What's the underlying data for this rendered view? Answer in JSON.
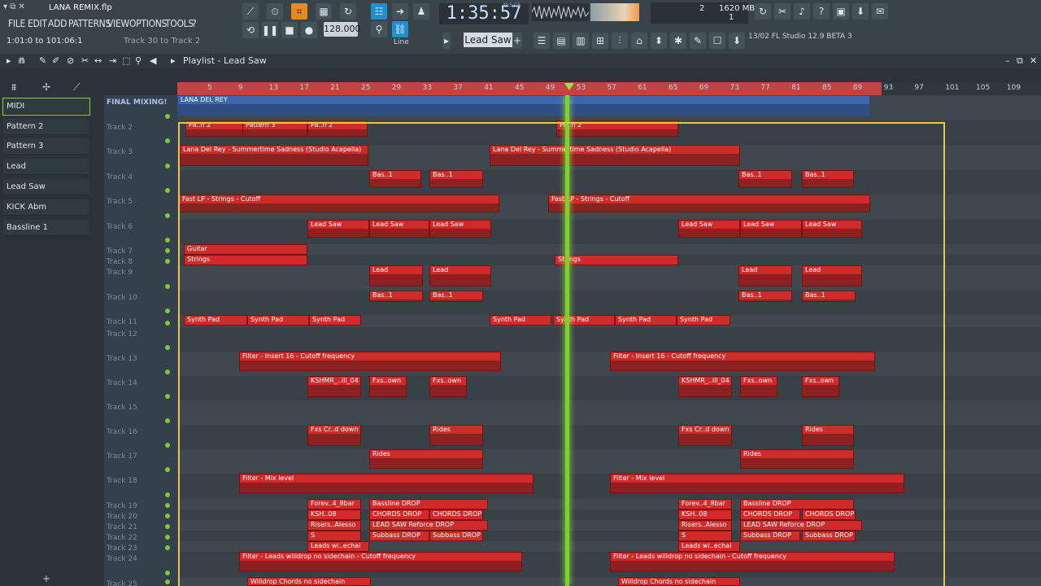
{
  "window": {
    "title": "LANA REMIX.flp",
    "position": "1:01:0 to 101:06:1",
    "hint_left": "Track 30 to Track 2"
  },
  "menu": [
    "FILE",
    "EDIT",
    "ADD",
    "PATTERNS",
    "VIEW",
    "OPTIONS",
    "TOOLS",
    "?"
  ],
  "transport": {
    "time": "1:35:57",
    "time_unit": "M:S:CS",
    "tempo": "128.000",
    "pattern": "Lead Saw",
    "snap": "Line",
    "cpu": "2",
    "memory": "1620 MB",
    "poly": "1"
  },
  "hint": "13/02  FL Studio 12.9 BETA 3",
  "playlist": {
    "title": "Playlist - Lead Saw"
  },
  "picker": [
    "MIDI",
    "Pattern 2",
    "Pattern 3",
    "Lead",
    "Lead Saw",
    "KICK Abm",
    "Bassline 1"
  ],
  "ruler": [
    "5",
    "9",
    "13",
    "17",
    "21",
    "25",
    "29",
    "33",
    "37",
    "41",
    "45",
    "49",
    "53",
    "57",
    "61",
    "65",
    "69",
    "73",
    "77",
    "81",
    "85",
    "89",
    "93",
    "97",
    "101",
    "105",
    "109"
  ],
  "tracks": [
    "FINAL MIXING!",
    "Track 2",
    "Track 3",
    "Track 4",
    "Track 5",
    "Track 6",
    "Track 7",
    "Track 8",
    "Track 9",
    "Track 10",
    "Track 11",
    "Track 12",
    "Track 13",
    "Track 14",
    "Track 15",
    "Track 16",
    "Track 17",
    "Track 18",
    "Track 19",
    "Track 20",
    "Track 21",
    "Track 22",
    "Track 23",
    "Track 24",
    "Track 25"
  ],
  "clips": {
    "final": "LANA DEL REY",
    "acap": "Lana Del Rey - Summertime Sadness (Studio Acapella)",
    "strings_lp": "Fast LP - Strings - Cutoff",
    "leadsaw": "Lead Saw",
    "guitar": "Guitar",
    "strings": "Strings",
    "lead": "Lead",
    "bas": "Bas..1",
    "synthpad": "Synth Pad",
    "filter16": "Filter - Insert 16 - Cutoff frequency",
    "kshmr": "KSHMR_..ill_04",
    "fxsdown": "Fxs..own",
    "fxscr": "Fxs Cr..d down",
    "rides": "Rides",
    "mixlevel": "Filter - Mix level",
    "forev": "Forev..4_8bar",
    "bassdrop": "Bassline DROP",
    "ksh": "KSH..08",
    "chords": "CHORDS DROP",
    "risers": "Risers..Alesso",
    "leadref": "LEAD SAW Reforce DROP",
    "subbass": "Subbass DROP",
    "leadsw": "Leads wi..echai",
    "leadswd": "Filter - Leads willdrop no sidechain - Cutoff frequency",
    "chordsns": "Willdrop Chords no sidechain",
    "pat3": "Pattern 3",
    "pan": "Pa..n 2"
  }
}
